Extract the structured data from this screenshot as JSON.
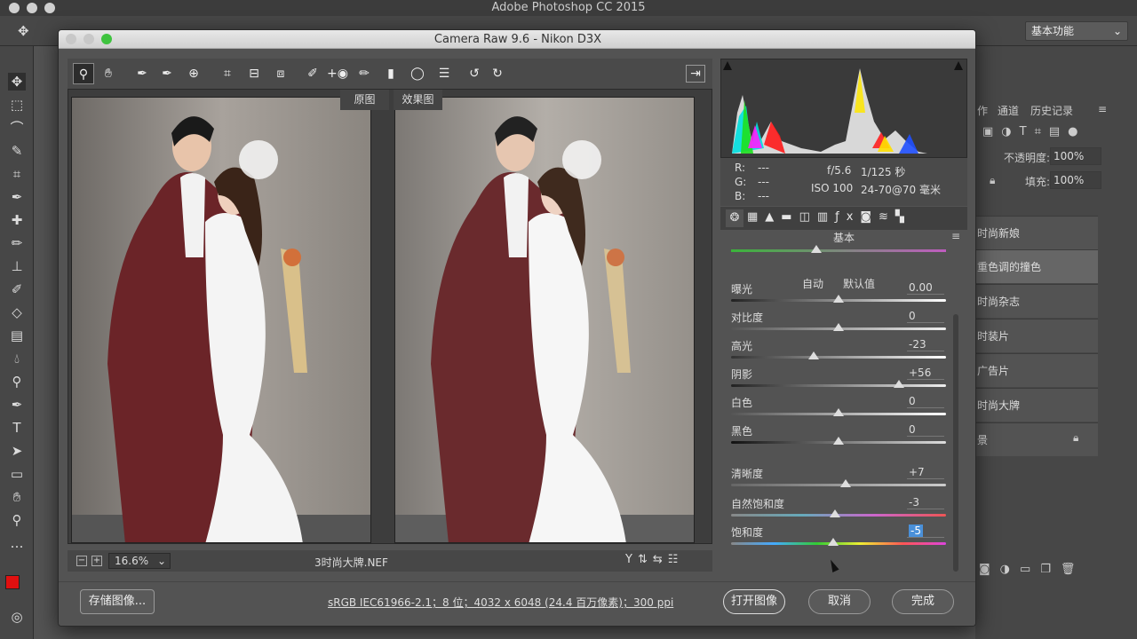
{
  "app": {
    "title": "Adobe Photoshop CC 2015",
    "workspace": "基本功能"
  },
  "ps_panels": {
    "tabs": [
      "作",
      "通道",
      "历史记录"
    ],
    "opacity_label": "不透明度:",
    "opacity_value": "100%",
    "fill_label": "填充:",
    "fill_value": "100%",
    "layers": [
      "时尚新娘",
      "重色调的撞色",
      "时尚杂志",
      "时装片",
      "广告片",
      "时尚大牌",
      "景"
    ]
  },
  "dialog": {
    "title": "Camera Raw 9.6 -  Nikon D3X",
    "compare": {
      "before": "原图",
      "after": "效果图"
    },
    "zoom": "16.6%",
    "filename": "3时尚大牌.NEF",
    "info": {
      "r": "R:",
      "g": "G:",
      "b": "B:",
      "r_val": "---",
      "g_val": "---",
      "b_val": "---",
      "aperture": "f/5.6",
      "shutter": "1/125 秒",
      "iso": "ISO 100",
      "lens": "24-70@70 毫米"
    },
    "panel": {
      "title": "基本",
      "auto": "自动",
      "default": "默认值",
      "sliders": [
        {
          "label": "曝光",
          "value": "0.00",
          "position": 0.5
        },
        {
          "label": "对比度",
          "value": "0",
          "position": 0.5
        },
        {
          "label": "高光",
          "value": "-23",
          "position": 0.385
        },
        {
          "label": "阴影",
          "value": "+56",
          "position": 0.78
        },
        {
          "label": "白色",
          "value": "0",
          "position": 0.5
        },
        {
          "label": "黑色",
          "value": "0",
          "position": 0.5
        },
        {
          "label": "清晰度",
          "value": "+7",
          "position": 0.535
        },
        {
          "label": "自然饱和度",
          "value": "-3",
          "position": 0.485
        },
        {
          "label": "饱和度",
          "value": "-5",
          "position": 0.475
        }
      ]
    },
    "footer": {
      "save": "存储图像...",
      "workflow": "sRGB IEC61966-2.1；8 位；4032 x 6048 (24.4 百万像素)；300 ppi",
      "open": "打开图像",
      "cancel": "取消",
      "done": "完成"
    }
  },
  "colors": {
    "accent_blue": "#4a90d9",
    "swatch_fg": "#e01010",
    "swatch_bg": "#ffffff"
  }
}
